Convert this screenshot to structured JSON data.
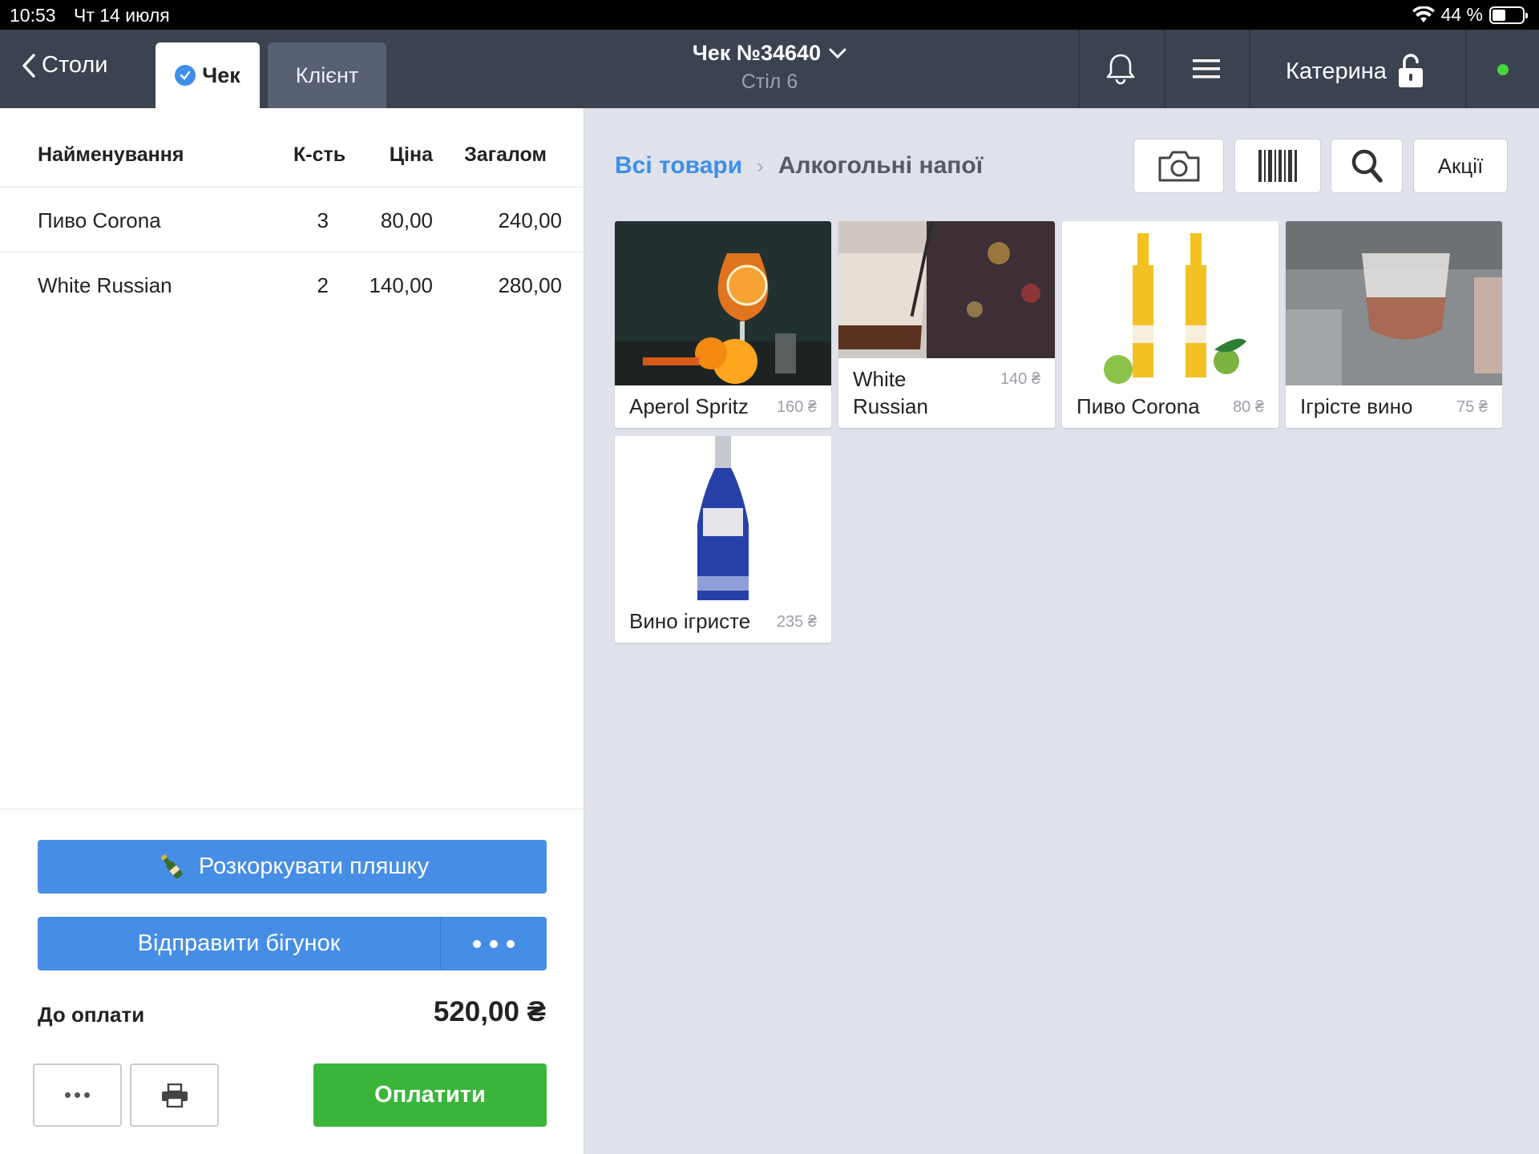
{
  "status_bar": {
    "time": "10:53",
    "date": "Чт 14 июля",
    "battery": "44 %",
    "battery_level": 0.44
  },
  "nav": {
    "back_label": "Столи",
    "tabs": [
      {
        "label": "Чек"
      },
      {
        "label": "Клієнт"
      }
    ],
    "title": "Чек №34640",
    "subtitle": "Стіл 6",
    "user": "Катерина"
  },
  "order": {
    "columns": {
      "name": "Найменування",
      "qty": "К-сть",
      "price": "Ціна",
      "total": "Загалом"
    },
    "rows": [
      {
        "name": "Пиво Corona",
        "qty": "3",
        "price": "80,00",
        "total": "240,00"
      },
      {
        "name": "White Russian",
        "qty": "2",
        "price": "140,00",
        "total": "280,00"
      }
    ],
    "uncork_label": "Розкоркувати пляшку",
    "send_label": "Відправити бігунок",
    "total_label": "До оплати",
    "total_value": "520,00 ₴",
    "pay_label": "Оплатити"
  },
  "catalog": {
    "breadcrumb_root": "Всі товари",
    "breadcrumb_sep": "›",
    "breadcrumb_current": "Алкогольні напої",
    "promo_label": "Акції",
    "products": [
      {
        "name": "Aperol Spritz",
        "price": "160 ₴"
      },
      {
        "name": "White Russian",
        "price": "140 ₴"
      },
      {
        "name": "Пиво Corona",
        "price": "80 ₴"
      },
      {
        "name": "Ігрісте вино",
        "price": "75 ₴"
      },
      {
        "name": "Вино ігристе",
        "price": "235 ₴"
      }
    ]
  },
  "colors": {
    "accent": "#468ee5",
    "pay": "#3ab53a",
    "nav_bg": "#3b4250",
    "online": "#43d63a"
  }
}
